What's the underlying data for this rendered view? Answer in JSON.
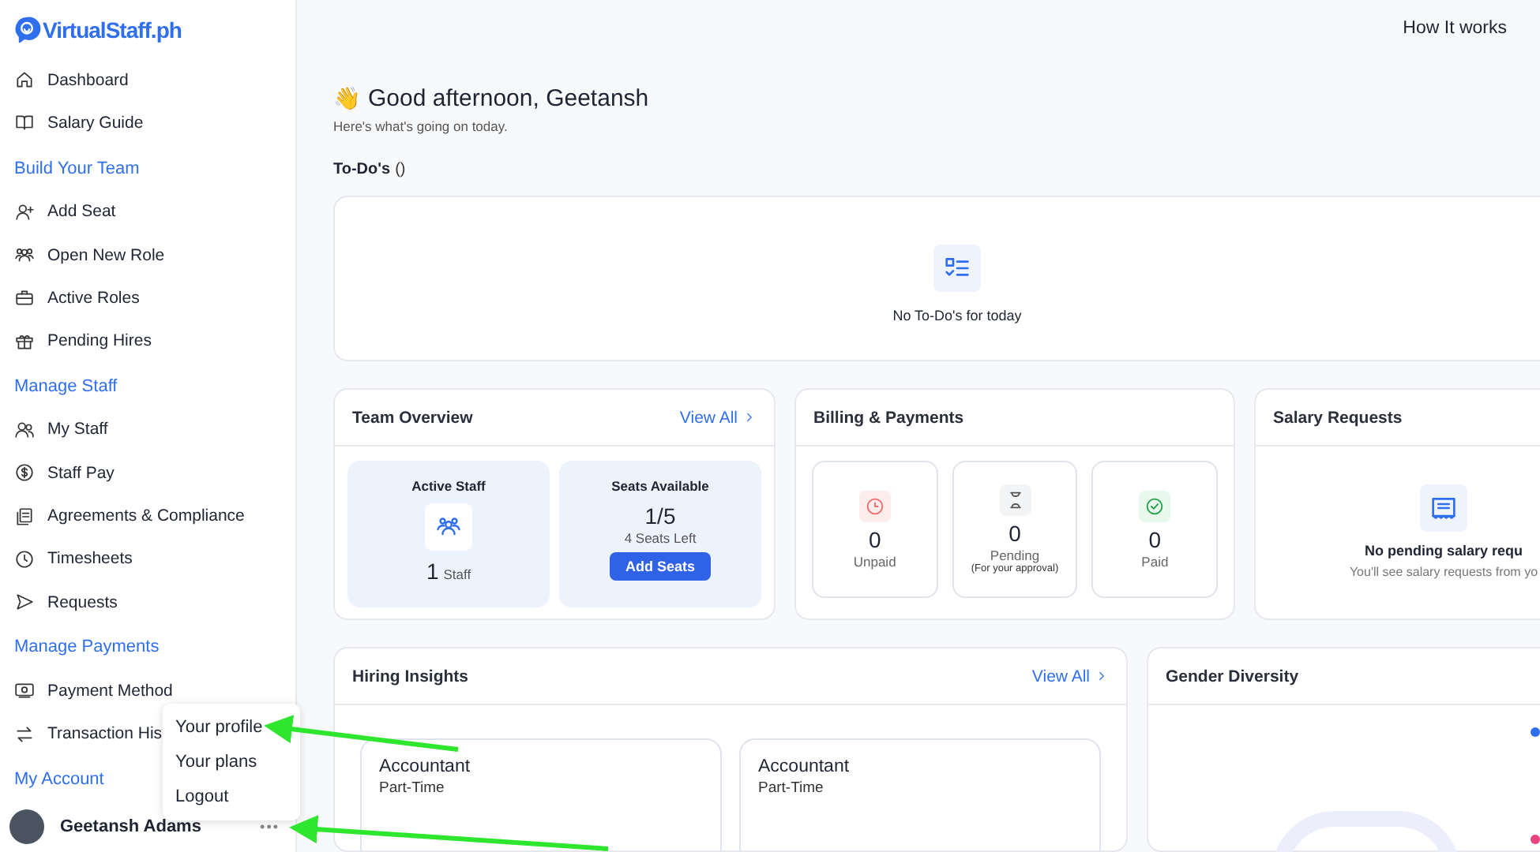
{
  "brand": {
    "name": "VirtualStaff.ph"
  },
  "sidebar": {
    "sections": [
      {
        "items": [
          {
            "label": "Dashboard"
          },
          {
            "label": "Salary Guide"
          }
        ]
      },
      {
        "heading": "Build Your Team",
        "items": [
          {
            "label": "Add Seat"
          },
          {
            "label": "Open New Role"
          },
          {
            "label": "Active Roles"
          },
          {
            "label": "Pending Hires"
          }
        ]
      },
      {
        "heading": "Manage Staff",
        "items": [
          {
            "label": "My Staff"
          },
          {
            "label": "Staff Pay"
          },
          {
            "label": "Agreements & Compliance"
          },
          {
            "label": "Timesheets"
          },
          {
            "label": "Requests"
          }
        ]
      },
      {
        "heading": "Manage Payments",
        "items": [
          {
            "label": "Payment Method"
          },
          {
            "label": "Transaction His"
          }
        ]
      },
      {
        "heading": "My Account"
      }
    ],
    "user": {
      "name": "Geetansh Adams",
      "more": "•••"
    }
  },
  "account_menu": {
    "items": [
      {
        "label": "Your profile"
      },
      {
        "label": "Your plans"
      },
      {
        "label": "Logout"
      }
    ]
  },
  "topbar": {
    "link": "How It works"
  },
  "greeting": {
    "emoji": "👋",
    "title": "Good afternoon, Geetansh",
    "subtitle": "Here's what's going on today."
  },
  "todos": {
    "title": "To-Do's",
    "count": "()",
    "empty": "No To-Do's for today"
  },
  "team_overview": {
    "title": "Team Overview",
    "link": "View All",
    "active_staff": {
      "title": "Active Staff",
      "count": "1",
      "unit": "Staff"
    },
    "seats": {
      "title": "Seats Available",
      "value": "1/5",
      "left": "4 Seats Left",
      "button": "Add Seats"
    }
  },
  "billing": {
    "title": "Billing & Payments",
    "tiles": [
      {
        "kind": "unpaid",
        "value": "0",
        "label": "Unpaid"
      },
      {
        "kind": "pending",
        "value": "0",
        "label": "Pending",
        "note": "(For your approval)"
      },
      {
        "kind": "paid",
        "value": "0",
        "label": "Paid"
      }
    ]
  },
  "salary_requests": {
    "title": "Salary Requests",
    "empty_title": "No pending salary requ",
    "empty_text": "You'll see salary requests from yo"
  },
  "hiring_insights": {
    "title": "Hiring Insights",
    "link": "View All",
    "roles": [
      {
        "title": "Accountant",
        "type": "Part-Time"
      },
      {
        "title": "Accountant",
        "type": "Part-Time"
      }
    ]
  },
  "gender_diversity": {
    "title": "Gender Diversity",
    "legend": [
      {
        "color": "#2f6fed"
      },
      {
        "color": "#e8457a"
      }
    ]
  }
}
